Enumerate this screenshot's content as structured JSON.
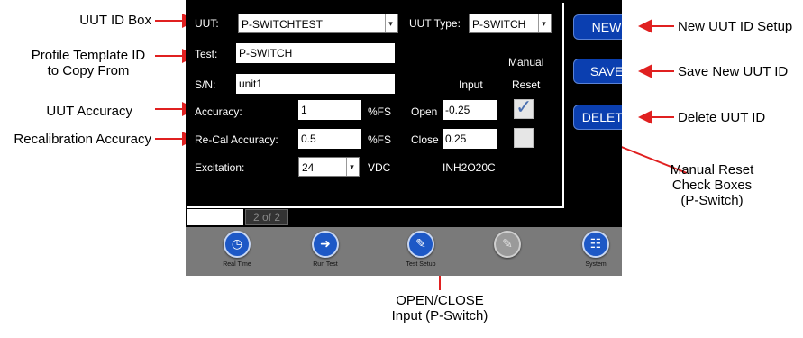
{
  "callouts": {
    "uut_id_box": "UUT ID Box",
    "profile_line1": "Profile Template ID",
    "profile_line2": "to Copy From",
    "uut_accuracy": "UUT Accuracy",
    "recal_accuracy": "Recalibration Accuracy",
    "new_setup": "New UUT ID Setup",
    "save_new": "Save New UUT ID",
    "delete_id": "Delete UUT ID",
    "manual_reset_line1": "Manual Reset",
    "manual_reset_line2": "Check Boxes",
    "manual_reset_line3": "(P-Switch)",
    "open_close_line1": "OPEN/CLOSE",
    "open_close_line2": "Input (P-Switch)"
  },
  "form": {
    "uut_label": "UUT:",
    "uut_value": "P-SWITCHTEST",
    "uut_type_label": "UUT Type:",
    "uut_type_value": "P-SWITCH",
    "test_label": "Test:",
    "test_value": "P-SWITCH",
    "sn_label": "S/N:",
    "sn_value": "unit1",
    "accuracy_label": "Accuracy:",
    "accuracy_value": "1",
    "accuracy_unit": "%FS",
    "recal_label": "Re-Cal Accuracy:",
    "recal_value": "0.5",
    "recal_unit": "%FS",
    "excitation_label": "Excitation:",
    "excitation_value": "24",
    "excitation_unit": "VDC",
    "manual_header": "Manual",
    "input_header": "Input",
    "reset_header": "Reset",
    "open_label": "Open",
    "open_value": "-0.25",
    "open_reset_checked": true,
    "close_label": "Close",
    "close_value": "0.25",
    "close_reset_checked": false,
    "device_id": "INH2O20C"
  },
  "buttons": {
    "new": "NEW",
    "save": "SAVE",
    "delete": "DELETE"
  },
  "pager": {
    "page": "2 of 2"
  },
  "nav": [
    {
      "label": "Real Time",
      "icon": "clock-icon",
      "enabled": true
    },
    {
      "label": "Run Test",
      "icon": "play-arrow-icon",
      "enabled": true
    },
    {
      "label": "Test Setup",
      "icon": "test-setup-icon",
      "enabled": true
    },
    {
      "label": "",
      "icon": "document-icon",
      "enabled": false
    },
    {
      "label": "System",
      "icon": "network-icon",
      "enabled": true
    }
  ],
  "colors": {
    "screen_bg": "#000000",
    "button_blue": "#0b3fb0",
    "nav_bar": "#7a7a7a",
    "arrow_red": "#e02020"
  }
}
